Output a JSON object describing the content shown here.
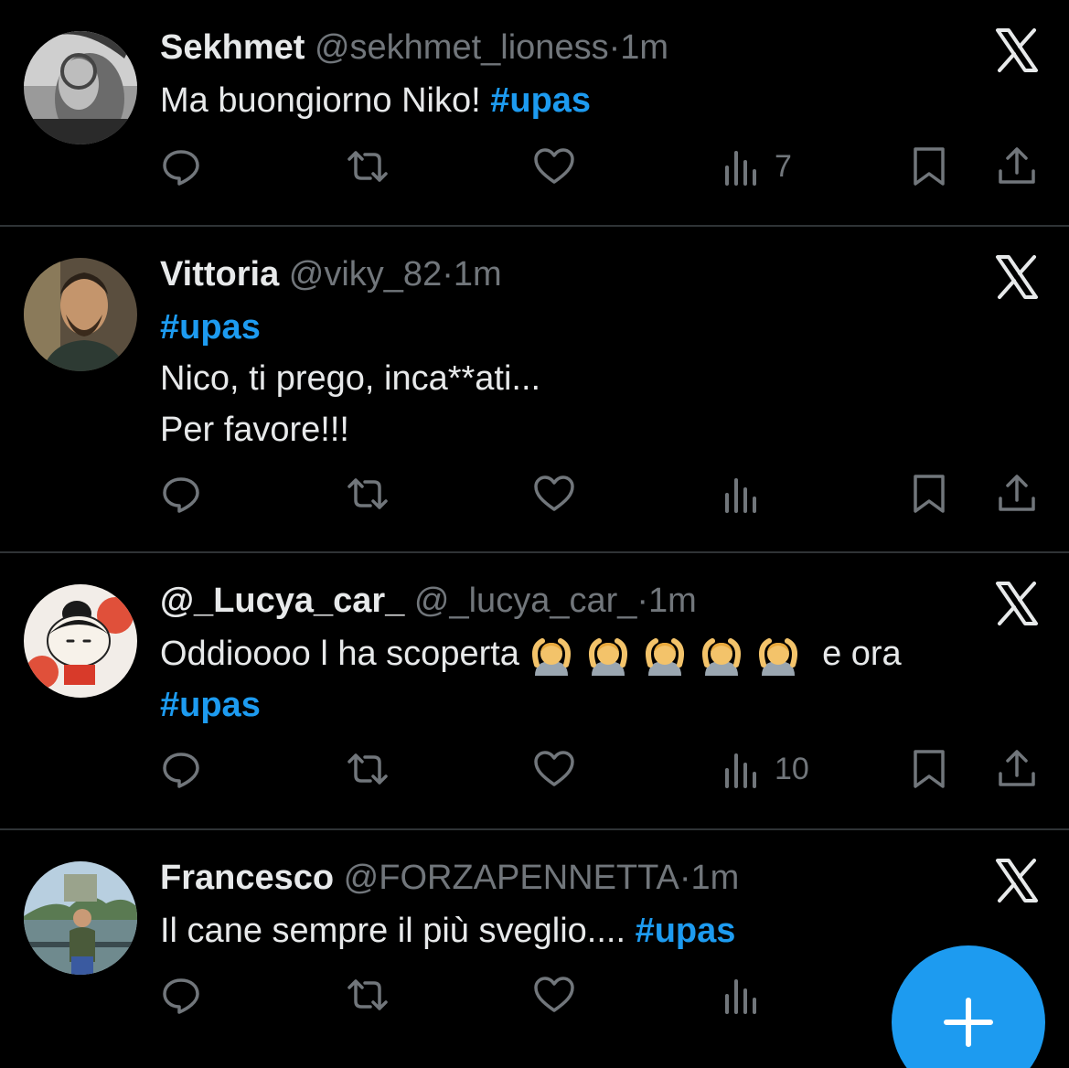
{
  "tweets": [
    {
      "name": "Sekhmet",
      "handle": "@sekhmet_lioness",
      "sep": "·",
      "time": "1m",
      "lines": [
        {
          "text": "Ma buongiorno Niko! ",
          "hashtag": "#upas"
        }
      ],
      "views": "7",
      "avatar_icon": "avatar-photo"
    },
    {
      "name": "Vittoria",
      "handle": "@viky_82",
      "sep": "·",
      "time": "1m",
      "lines": [
        {
          "text": "",
          "hashtag": "#upas"
        },
        {
          "text": "Nico, ti prego, inca**ati...",
          "hashtag": ""
        },
        {
          "text": "Per favore!!!",
          "hashtag": ""
        }
      ],
      "views": "",
      "avatar_icon": "avatar-photo"
    },
    {
      "name": "@_Lucya_car_",
      "handle": "@_lucya_car_",
      "sep": "·",
      "time": "1m",
      "lines": [
        {
          "text": "Oddioooo l ha scoperta",
          "hashtag": "",
          "suffix": "e ora"
        },
        {
          "text": "",
          "hashtag": "#upas"
        }
      ],
      "views": "10",
      "avatar_icon": "avatar-photo"
    },
    {
      "name": "Francesco",
      "handle": "@FORZAPENNETTA",
      "sep": "·",
      "time": "1m",
      "lines": [
        {
          "text": "Il cane sempre il più sveglio.... ",
          "hashtag": "#upas"
        }
      ],
      "views": "",
      "avatar_icon": "avatar-photo"
    }
  ],
  "colors": {
    "background": "#000000",
    "text": "#e7e9ea",
    "secondary": "#71767b",
    "accent": "#1d9bf0",
    "divider": "#2f3336"
  },
  "icons": {
    "reply": "reply-icon",
    "retweet": "retweet-icon",
    "like": "heart-icon",
    "views": "views-icon",
    "bookmark": "bookmark-icon",
    "share": "share-icon",
    "platform": "x-logo-icon",
    "compose": "plus-icon"
  }
}
